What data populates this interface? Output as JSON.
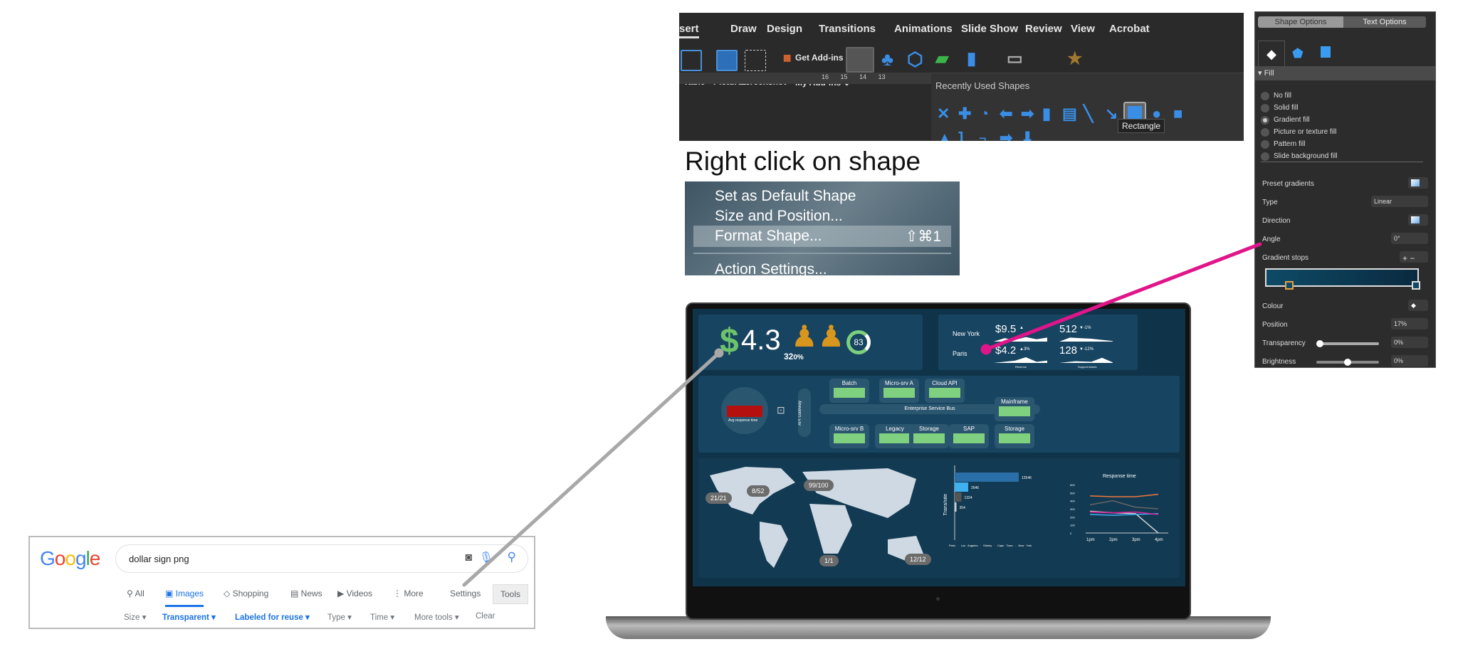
{
  "ribbon": {
    "tabs": [
      "sert",
      "Draw",
      "Design",
      "Transitions",
      "Animations",
      "Slide Show",
      "Review",
      "View",
      "Acrobat"
    ],
    "buttons": {
      "table": "Table",
      "pictures": "Pictures",
      "screenshot": "Screenshot",
      "get_addins": "Get Add-ins",
      "my_addins": "My Add-ins ⌄"
    },
    "ruler": [
      "16",
      "15",
      "14",
      "13"
    ],
    "gallery_title": "Recently Used Shapes",
    "tooltip": "Rectangle"
  },
  "instruction": "Right click on shape",
  "context_menu": {
    "items": [
      "Set as Default Shape",
      "Size and Position...",
      "Format Shape...",
      "Action Settings..."
    ],
    "shortcut": "⇧⌘1",
    "highlighted": "Format Shape..."
  },
  "format_panel": {
    "tabs": [
      "Shape Options",
      "Text Options"
    ],
    "section": "Fill",
    "fill_options": [
      "No fill",
      "Solid fill",
      "Gradient fill",
      "Picture or texture fill",
      "Pattern fill",
      "Slide background fill"
    ],
    "selected_fill": "Gradient fill",
    "labels": {
      "preset": "Preset gradients",
      "type": "Type",
      "direction": "Direction",
      "angle": "Angle",
      "stops": "Gradient stops",
      "colour": "Colour",
      "position": "Position",
      "transparency": "Transparency",
      "brightness": "Brightness"
    },
    "values": {
      "type": "Linear",
      "angle": "0°",
      "position": "17%",
      "transparency": "0%",
      "brightness": "0%"
    },
    "sliders": {
      "transparency": 0,
      "brightness": 0.5
    },
    "gradient_colors": [
      "#0e4a66",
      "#0a2a40"
    ]
  },
  "dashboard": {
    "kpi_value": "4.3",
    "kpi_symbol": "$",
    "people_value": "32",
    "people_unit": "0%",
    "gauge": "83",
    "cities": [
      "New York",
      "Paris"
    ],
    "metrics": [
      {
        "value": "$9.5",
        "delta": "▲"
      },
      {
        "value": "512",
        "delta": "▼-1%"
      },
      {
        "value": "$4.2",
        "delta": "▲3%"
      },
      {
        "value": "128",
        "delta": "▼-12%"
      }
    ],
    "metric_captions": [
      "Revenue",
      "Support tickets"
    ],
    "avg_response": "Avg response time",
    "api_gateway": "API Gateway",
    "esb": "Enterprise Service Bus",
    "nodes_top": [
      "Batch",
      "Micro-srv A",
      "Cloud API"
    ],
    "nodes_bottom": [
      "Micro-srv B",
      "Legacy",
      "Storage",
      "SAP",
      "Storage"
    ],
    "mainframe": "Mainframe",
    "map_pins": [
      "21/21",
      "8/52",
      "99/100",
      "1/1",
      "12/12"
    ],
    "bar_chart": {
      "ylabel": "Trans/site",
      "values": [
        12546,
        2646,
        1324,
        354
      ],
      "colors": [
        "#2a6fa8",
        "#3fb0f0",
        "#555",
        "#ccc"
      ]
    },
    "line_chart": {
      "title": "Response time",
      "yticks": [
        "600",
        "500",
        "400",
        "300",
        "200",
        "100",
        "0"
      ],
      "xticks": [
        "1pm",
        "2pm",
        "3pm",
        "4pm"
      ],
      "series": [
        {
          "color": "#f07840",
          "values": [
            460,
            450,
            450,
            480
          ]
        },
        {
          "color": "#666",
          "values": [
            350,
            400,
            320,
            300
          ]
        },
        {
          "color": "#ccc",
          "values": [
            270,
            250,
            240,
            0
          ]
        },
        {
          "color": "#3fb0f0",
          "values": [
            230,
            220,
            230,
            240
          ]
        },
        {
          "color": "#e020a0",
          "values": [
            260,
            250,
            260,
            230
          ]
        }
      ]
    },
    "legend": [
      "Paris",
      "Los Angeles",
      "Sidney",
      "Cape Town",
      "New York"
    ]
  },
  "google": {
    "query": "dollar sign png",
    "nav": [
      "All",
      "Images",
      "Shopping",
      "News",
      "Videos",
      "More"
    ],
    "settings": "Settings",
    "tools": "Tools",
    "filters": [
      "Size ▾",
      "Transparent ▾",
      "Labeled for reuse ▾",
      "Type ▾",
      "Time ▾",
      "More tools ▾",
      "Clear"
    ],
    "active_nav": "Images"
  },
  "callout_colors": {
    "gray": "#a8a8a8",
    "pink": "#e0158a"
  }
}
